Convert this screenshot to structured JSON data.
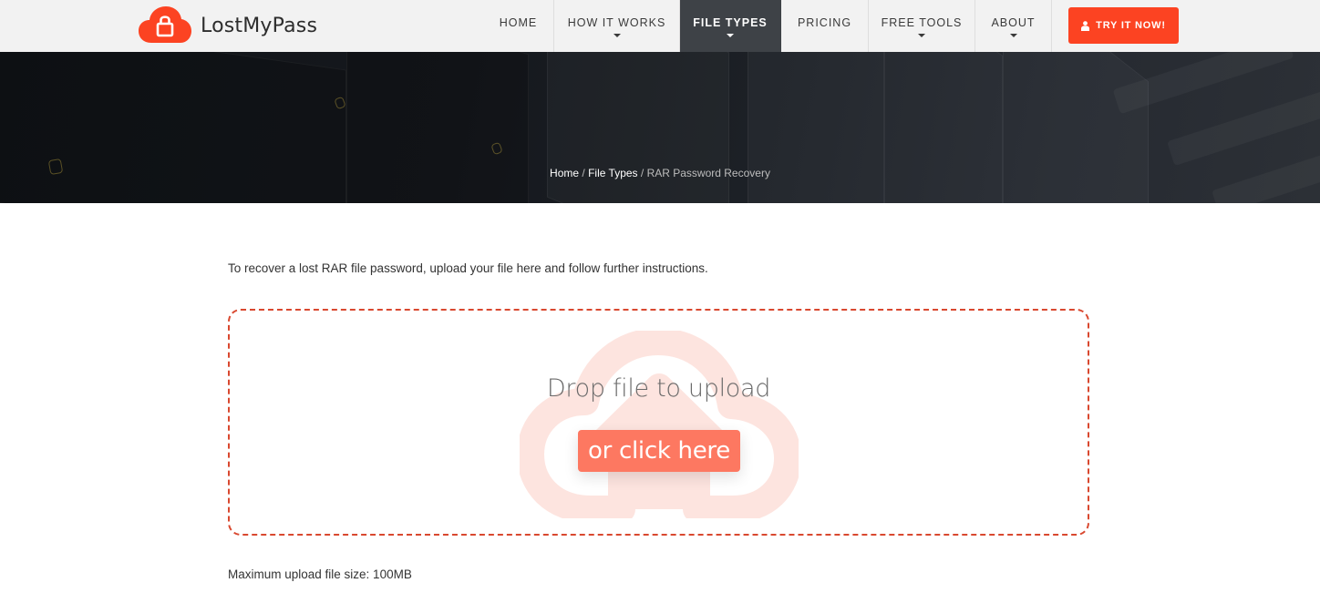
{
  "header": {
    "logo_text": "LostMyPass",
    "nav": [
      {
        "label": "HOME",
        "has_dropdown": false,
        "active": false
      },
      {
        "label": "HOW IT WORKS",
        "has_dropdown": true,
        "active": false
      },
      {
        "label": "FILE TYPES",
        "has_dropdown": true,
        "active": true
      },
      {
        "label": "PRICING",
        "has_dropdown": false,
        "active": false
      },
      {
        "label": "FREE TOOLS",
        "has_dropdown": true,
        "active": false
      },
      {
        "label": "ABOUT",
        "has_dropdown": true,
        "active": false
      }
    ],
    "cta_label": "TRY IT NOW!",
    "cta_icon": "user-icon"
  },
  "hero": {
    "breadcrumb": [
      {
        "label": "Home",
        "link": true
      },
      {
        "label": "File Types",
        "link": true
      },
      {
        "label": "RAR Password Recovery",
        "link": false
      }
    ],
    "separator": "/"
  },
  "main": {
    "intro": "To recover a lost RAR file password, upload your file here and follow further instructions.",
    "dropzone": {
      "title": "Drop file to upload",
      "button_label": "or click here",
      "background_icon": "cloud-upload-icon"
    },
    "max_size": "Maximum upload file size: 100MB"
  },
  "colors": {
    "brand": "#fc4322",
    "nav_active_bg": "#3e4247",
    "dropzone_border": "#d9482f",
    "click_button": "#fd7861",
    "header_bg": "#f2f2f2"
  }
}
